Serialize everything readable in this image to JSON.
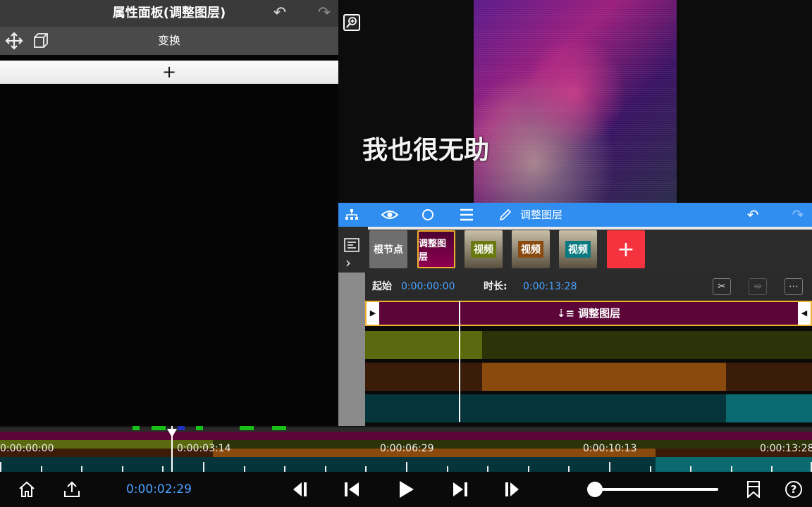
{
  "property_panel": {
    "title": "属性面板(调整图层)",
    "tab_label": "变换",
    "add_label": "+",
    "icons": [
      "undo-icon",
      "redo-icon",
      "move-icon",
      "cube-icon"
    ]
  },
  "preview": {
    "subtitle": "我也很无助"
  },
  "layer_toolbar": {
    "layer_name": "调整图层",
    "icons": [
      "hierarchy-icon",
      "eye-icon",
      "circle-icon",
      "menu-icon",
      "pencil-icon",
      "undo-icon",
      "redo-icon"
    ]
  },
  "layer_strip": {
    "nodes": [
      {
        "label": "根节点"
      },
      {
        "label": "调整图层"
      },
      {
        "label": "视频"
      },
      {
        "label": "视频"
      },
      {
        "label": "视频"
      }
    ],
    "add_label": "+"
  },
  "info_bar": {
    "start_label": "起始",
    "start_value": "0:00:00:00",
    "duration_label": "时长:",
    "duration_value": "0:00:13:28"
  },
  "timeline": {
    "adjust_clip_label": "调整图层",
    "track_colors": [
      "#5b6a0e",
      "#8a4a0e",
      "#0a6a70"
    ]
  },
  "overview": {
    "time_marks": [
      "0:00:00:00",
      "0:00:03:14",
      "0:00:06:29",
      "0:00:10:13",
      "0:00:13:28"
    ]
  },
  "transport": {
    "current_time": "0:00:02:29",
    "volume": 0.0
  },
  "colors": {
    "accent_blue": "#2f8ef0",
    "time_blue": "#4aa3ff",
    "adjust_layer": "#5b0538",
    "add_red": "#f4333e",
    "selection_gold": "#f0b030"
  }
}
